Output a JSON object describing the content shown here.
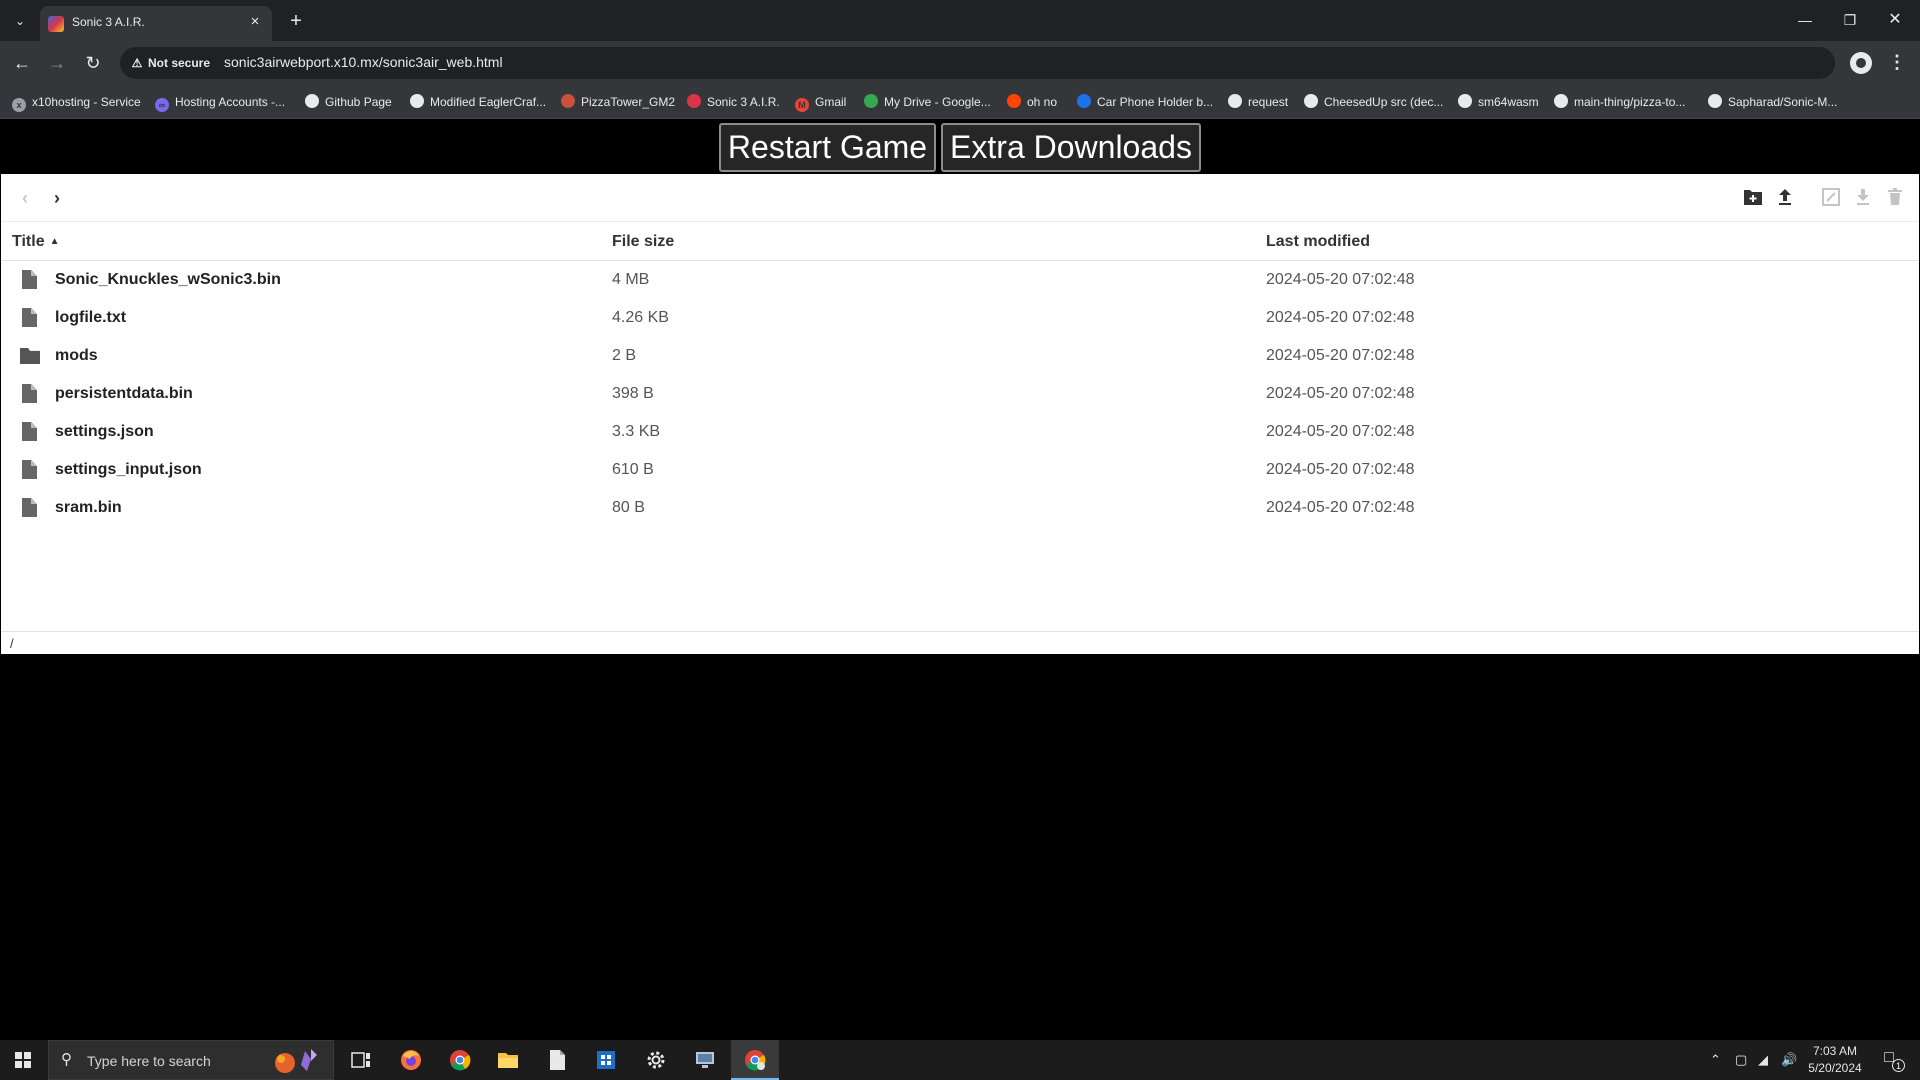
{
  "browser": {
    "tab_title": "Sonic 3 A.I.R.",
    "security_label": "Not secure",
    "url": "sonic3airwebport.x10.mx/sonic3air_web.html",
    "bookmarks": [
      {
        "label": "x10hosting - Service",
        "icon": "x10-icon",
        "color": "#9aa0a6"
      },
      {
        "label": "Hosting Accounts -...",
        "icon": "infinity-icon",
        "color": "#7b68ee"
      },
      {
        "label": "Github Page",
        "icon": "github-icon",
        "color": "#e8eaed"
      },
      {
        "label": "Modified EaglerCraf...",
        "icon": "globe-icon",
        "color": "#e8eaed"
      },
      {
        "label": "PizzaTower_GM2",
        "icon": "pizza-tower-icon",
        "color": "#c9503a"
      },
      {
        "label": "Sonic 3 A.I.R.",
        "icon": "sonic-air-icon",
        "color": "#d8344a"
      },
      {
        "label": "Gmail",
        "icon": "gmail-icon",
        "color": "#ea4335"
      },
      {
        "label": "My Drive - Google...",
        "icon": "google-drive-icon",
        "color": "#34a853"
      },
      {
        "label": "oh no",
        "icon": "reddit-icon",
        "color": "#ff4500"
      },
      {
        "label": "Car Phone Holder b...",
        "icon": "bookmark-site-icon",
        "color": "#1a73e8"
      },
      {
        "label": "request",
        "icon": "github-icon",
        "color": "#e8eaed"
      },
      {
        "label": "CheesedUp src (dec...",
        "icon": "github-icon",
        "color": "#e8eaed"
      },
      {
        "label": "sm64wasm",
        "icon": "github-icon",
        "color": "#e8eaed"
      },
      {
        "label": "main-thing/pizza-to...",
        "icon": "github-icon",
        "color": "#e8eaed"
      },
      {
        "label": "Sapharad/Sonic-M...",
        "icon": "github-icon",
        "color": "#e8eaed"
      }
    ]
  },
  "page": {
    "restart_label": "Restart Game",
    "extra_label": "Extra Downloads"
  },
  "file_manager": {
    "columns": {
      "title": "Title",
      "size": "File size",
      "modified": "Last modified"
    },
    "sort": {
      "column": "title",
      "direction": "ascending"
    },
    "path": "/",
    "files": [
      {
        "name": "Sonic_Knuckles_wSonic3.bin",
        "size": "4 MB",
        "modified": "2024-05-20 07:02:48",
        "type": "file"
      },
      {
        "name": "logfile.txt",
        "size": "4.26 KB",
        "modified": "2024-05-20 07:02:48",
        "type": "file"
      },
      {
        "name": "mods",
        "size": "2 B",
        "modified": "2024-05-20 07:02:48",
        "type": "folder"
      },
      {
        "name": "persistentdata.bin",
        "size": "398 B",
        "modified": "2024-05-20 07:02:48",
        "type": "file"
      },
      {
        "name": "settings.json",
        "size": "3.3 KB",
        "modified": "2024-05-20 07:02:48",
        "type": "file"
      },
      {
        "name": "settings_input.json",
        "size": "610 B",
        "modified": "2024-05-20 07:02:48",
        "type": "file"
      },
      {
        "name": "sram.bin",
        "size": "80 B",
        "modified": "2024-05-20 07:02:48",
        "type": "file"
      }
    ],
    "actions": [
      {
        "name": "new-folder-icon",
        "enabled": true
      },
      {
        "name": "upload-icon",
        "enabled": true
      },
      {
        "name": "rename-icon",
        "enabled": false
      },
      {
        "name": "download-icon",
        "enabled": false
      },
      {
        "name": "delete-icon",
        "enabled": false
      }
    ]
  },
  "taskbar": {
    "search_placeholder": "Type here to search",
    "apps": [
      "task-view-icon",
      "firefox-icon",
      "chrome-icon",
      "file-explorer-icon",
      "notepad-icon",
      "store-icon",
      "settings-icon",
      "remote-desktop-icon",
      "chrome-profile-icon"
    ],
    "time": "7:03 AM",
    "date": "5/20/2024",
    "notification_count": "1"
  },
  "colors": {
    "accent": "#8ab4f8",
    "chrome_dark": "#202124",
    "chrome_toolbar": "#35363a",
    "taskbar_active": "#76b9ed"
  }
}
